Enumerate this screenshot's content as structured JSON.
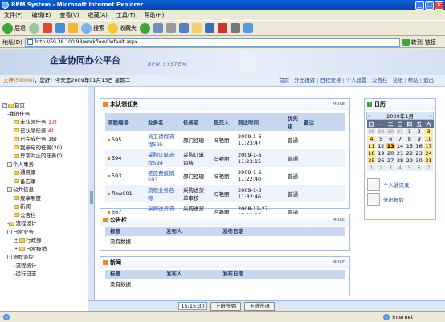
{
  "window": {
    "title": "BPM System - Microsoft Internet Explorer"
  },
  "menu": [
    "文件(F)",
    "编辑(E)",
    "查看(V)",
    "收藏(A)",
    "工具(T)",
    "帮助(H)"
  ],
  "toolbar": {
    "back": "后退",
    "search": "搜索",
    "favorites": "收藏夹"
  },
  "address": {
    "label": "地址(D)",
    "url": "http://59.36.100.98/workflow/Default.aspx",
    "go": "转到",
    "links": "链接"
  },
  "header": {
    "logo": "企业协同办公平台",
    "subtitle": "BPM SYSTEM"
  },
  "infobar": {
    "user": "文梓(50000)",
    "greeting": "，您好！今天是2009年01月13日 星期二"
  },
  "topnav": [
    "首页",
    "外出报奴",
    "日程安排",
    "个人设置",
    "公告栏",
    "论坛",
    "帮助",
    "退出"
  ],
  "tree": {
    "root": "首页",
    "my_tasks": "我的任务",
    "todo": "未认领任务",
    "todo_count": "(17)",
    "claimed": "已认领任务",
    "claimed_count": "(4)",
    "completed": "已完成任务(16)",
    "initiated": "我参与的任务(20)",
    "abandoned": "异常对止的任务(0)",
    "personal": "个人事务",
    "contacts": "通讯录",
    "memo": "备忘录",
    "public": "公共信息",
    "rules": "规章制度",
    "news": "新闻",
    "notice": "公告栏",
    "flow_design": "流程设计",
    "daily": "日常业务",
    "admin": "行政部",
    "daily_report": "日常报销",
    "flow_monitor": "流程监控",
    "flow_stats": "流程统计",
    "run_log": "运行日志"
  },
  "tasks": {
    "title": "未认领任务",
    "more": "MORE",
    "headers": [
      "流程编号",
      "业务名",
      "任务名",
      "提交人",
      "到达时间",
      "优先级",
      "备注"
    ],
    "rows": [
      {
        "id": "595",
        "biz": "员工请假流程595",
        "task": "部门经理",
        "by": "冯艳丽",
        "time": "2009-1-6 11:23:47",
        "pri": "普通"
      },
      {
        "id": "594",
        "biz": "采购订单流程594",
        "task": "采购订单审核",
        "by": "冯艳丽",
        "time": "2009-1-6 11:23:15",
        "pri": "普通"
      },
      {
        "id": "593",
        "biz": "差旅费报销593",
        "task": "部门经理",
        "by": "冯艳丽",
        "time": "2009-1-6 11:22:40",
        "pri": "普通"
      },
      {
        "id": "flow001",
        "biz": "流程业务名称",
        "task": "采购进货单审核",
        "by": "冯艳丽",
        "time": "2009-1-3 11:32:46",
        "pri": "普通"
      },
      {
        "id": "567",
        "biz": "采购进货流程567",
        "task": "采购进货单审核",
        "by": "冯艳丽",
        "time": "2008-12-27 17:22:05",
        "pri": "普通"
      }
    ]
  },
  "notice": {
    "title": "公告栏",
    "more": "MORE",
    "headers": [
      "标题",
      "发布人",
      "发布日期"
    ],
    "empty": "没有数据"
  },
  "newsbox": {
    "title": "新闻",
    "more": "MORE",
    "headers": [
      "标题",
      "发布人",
      "发布日期"
    ],
    "empty": "没有数据"
  },
  "calendar": {
    "title": "日历",
    "month": "2009年1月",
    "weekdays": [
      "日",
      "一",
      "二",
      "三",
      "四",
      "五",
      "六"
    ],
    "weeks": [
      [
        "28",
        "29",
        "30",
        "31",
        "1",
        "2",
        "3"
      ],
      [
        "4",
        "5",
        "6",
        "7",
        "8",
        "9",
        "10"
      ],
      [
        "11",
        "12",
        "13",
        "14",
        "15",
        "16",
        "17"
      ],
      [
        "18",
        "19",
        "20",
        "21",
        "22",
        "23",
        "24"
      ],
      [
        "25",
        "26",
        "27",
        "28",
        "29",
        "30",
        "31"
      ],
      [
        "1",
        "2",
        "3",
        "4",
        "5",
        "6",
        "7"
      ]
    ],
    "today": "13"
  },
  "side_links": {
    "contacts": "个人通讯录",
    "out": "外出报奴"
  },
  "bottombar": {
    "clock": "15:15:30",
    "checkin": "上班签到",
    "checkout": "下班签退"
  },
  "status": {
    "zone": "Internet"
  }
}
